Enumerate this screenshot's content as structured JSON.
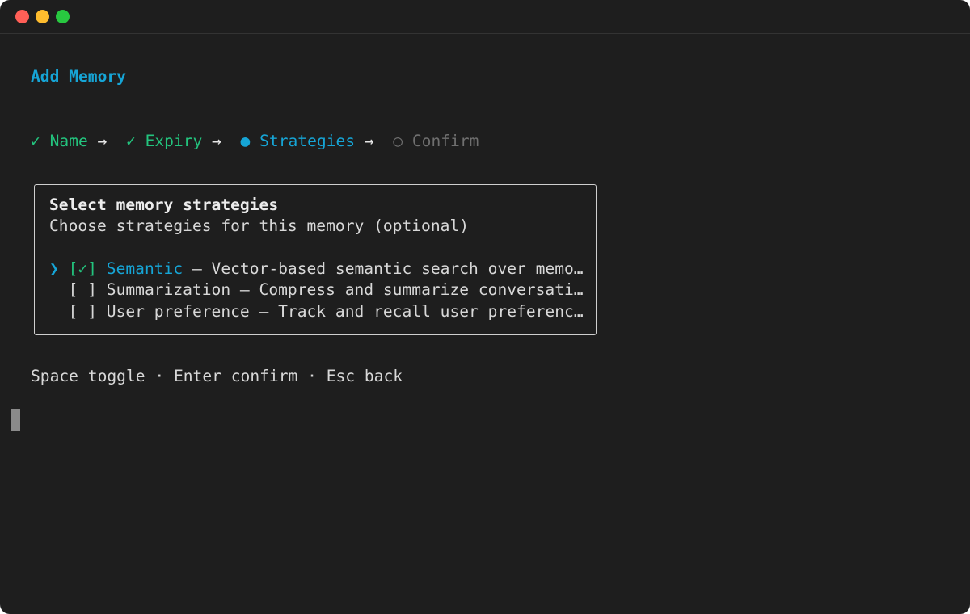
{
  "title": "Add Memory",
  "steps": [
    {
      "symbol": "✓",
      "label": "Name",
      "state": "done"
    },
    {
      "symbol": "✓",
      "label": "Expiry",
      "state": "done"
    },
    {
      "symbol": "●",
      "label": "Strategies",
      "state": "active"
    },
    {
      "symbol": "○",
      "label": "Confirm",
      "state": "pending"
    }
  ],
  "step_separator": "→",
  "panel": {
    "heading": "Select memory strategies",
    "subheading": "Choose strategies for this memory (optional)",
    "options": [
      {
        "pointer": "❯",
        "checkbox": "[✓]",
        "name": "Semantic",
        "description": " – Vector-based semantic search over memo…",
        "selected": true
      },
      {
        "pointer": " ",
        "checkbox": "[ ]",
        "name": "Summarization",
        "description": " – Compress and summarize conversati…",
        "selected": false
      },
      {
        "pointer": " ",
        "checkbox": "[ ]",
        "name": "User preference",
        "description": " – Track and recall user preferenc…",
        "selected": false
      }
    ]
  },
  "hints": "Space toggle · Enter confirm · Esc back",
  "colors": {
    "accent": "#16a5d6",
    "done": "#23c47e",
    "pending": "#6f6f6f",
    "background": "#1e1e1e"
  }
}
